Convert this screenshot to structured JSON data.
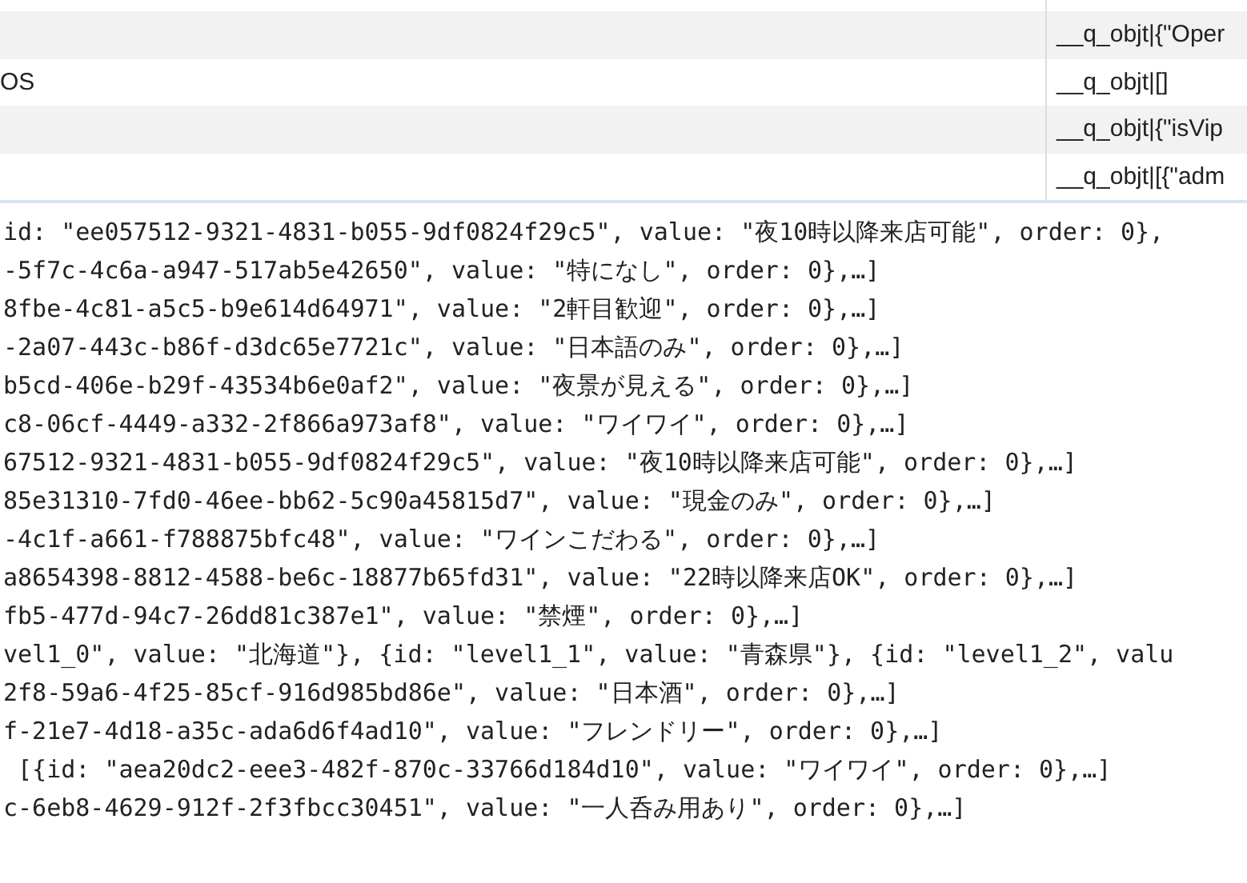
{
  "table": {
    "rows": [
      {
        "key": "",
        "value": ""
      },
      {
        "key": "",
        "value": "__q_objt|{\"Oper"
      },
      {
        "key": "OS",
        "value": "__q_objt|[]"
      },
      {
        "key": "",
        "value": "__q_objt|{\"isVip"
      },
      {
        "key": "",
        "value": "__q_objt|[{\"adm"
      }
    ]
  },
  "code_lines": [
    "id: \"ee057512-9321-4831-b055-9df0824f29c5\", value: \"夜10時以降来店可能\", order: 0},",
    "-5f7c-4c6a-a947-517ab5e42650\", value: \"特になし\", order: 0},…]",
    "8fbe-4c81-a5c5-b9e614d64971\", value: \"2軒目歓迎\", order: 0},…]",
    "-2a07-443c-b86f-d3dc65e7721c\", value: \"日本語のみ\", order: 0},…]",
    "b5cd-406e-b29f-43534b6e0af2\", value: \"夜景が見える\", order: 0},…]",
    "c8-06cf-4449-a332-2f866a973af8\", value: \"ワイワイ\", order: 0},…]",
    "67512-9321-4831-b055-9df0824f29c5\", value: \"夜10時以降来店可能\", order: 0},…]",
    "85e31310-7fd0-46ee-bb62-5c90a45815d7\", value: \"現金のみ\", order: 0},…]",
    "-4c1f-a661-f788875bfc48\", value: \"ワインこだわる\", order: 0},…]",
    "a8654398-8812-4588-be6c-18877b65fd31\", value: \"22時以降来店OK\", order: 0},…]",
    "fb5-477d-94c7-26dd81c387e1\", value: \"禁煙\", order: 0},…]",
    "vel1_0\", value: \"北海道\"}, {id: \"level1_1\", value: \"青森県\"}, {id: \"level1_2\", valu",
    "2f8-59a6-4f25-85cf-916d985bd86e\", value: \"日本酒\", order: 0},…]",
    "f-21e7-4d18-a35c-ada6d6f4ad10\", value: \"フレンドリー\", order: 0},…]",
    " [{id: \"aea20dc2-eee3-482f-870c-33766d184d10\", value: \"ワイワイ\", order: 0},…]",
    "c-6eb8-4629-912f-2f3fbcc30451\", value: \"一人呑み用あり\", order: 0},…]"
  ]
}
